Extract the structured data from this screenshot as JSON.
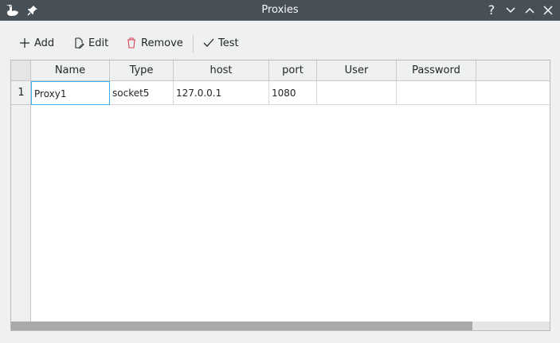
{
  "window": {
    "title": "Proxies",
    "help_label": "?"
  },
  "toolbar": {
    "add_label": "Add",
    "edit_label": "Edit",
    "remove_label": "Remove",
    "test_label": "Test",
    "remove_color": "#da4453"
  },
  "table": {
    "columns": [
      "Name",
      "Type",
      "host",
      "port",
      "User",
      "Password"
    ],
    "rows": [
      {
        "index": "1",
        "cells": [
          "Proxy1",
          "socket5",
          "127.0.0.1",
          "1080",
          "",
          ""
        ]
      }
    ],
    "selection_color": "#3daee9"
  }
}
